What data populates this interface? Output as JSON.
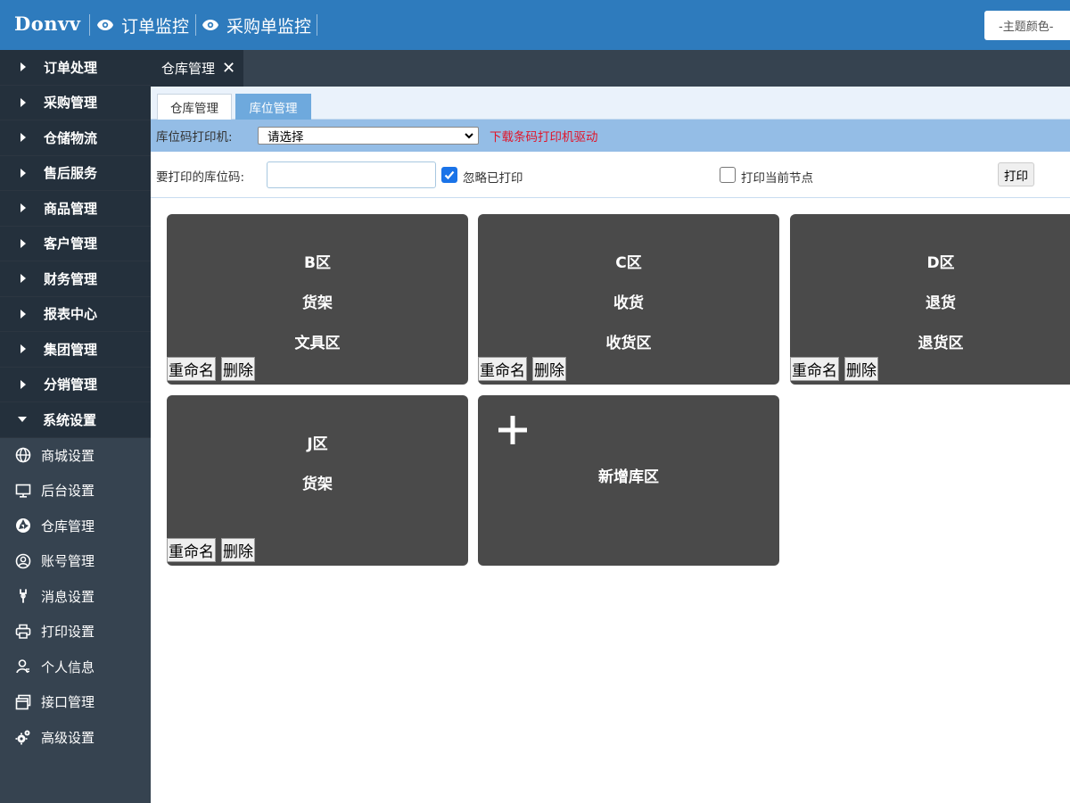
{
  "header": {
    "logo": "Donvv",
    "nav": [
      {
        "label": "订单监控",
        "icon": "eye-icon"
      },
      {
        "label": "采购单监控",
        "icon": "eye-icon"
      }
    ],
    "theme_button": "-主题颜色-"
  },
  "sidebar": {
    "menus": [
      {
        "label": "订单处理"
      },
      {
        "label": "采购管理"
      },
      {
        "label": "仓储物流"
      },
      {
        "label": "售后服务"
      },
      {
        "label": "商品管理"
      },
      {
        "label": "客户管理"
      },
      {
        "label": "财务管理"
      },
      {
        "label": "报表中心"
      },
      {
        "label": "集团管理"
      },
      {
        "label": "分销管理"
      },
      {
        "label": "系统设置"
      }
    ],
    "sub_items": [
      {
        "label": "商城设置",
        "icon": "globe-icon"
      },
      {
        "label": "后台设置",
        "icon": "monitor-icon"
      },
      {
        "label": "仓库管理",
        "icon": "aperture-icon"
      },
      {
        "label": "账号管理",
        "icon": "user-circle-icon"
      },
      {
        "label": "消息设置",
        "icon": "wrench-icon"
      },
      {
        "label": "打印设置",
        "icon": "printer-icon"
      },
      {
        "label": "个人信息",
        "icon": "user-icon"
      },
      {
        "label": "接口管理",
        "icon": "windows-icon"
      },
      {
        "label": "高级设置",
        "icon": "gears-icon"
      }
    ]
  },
  "page_tab": {
    "label": "仓库管理",
    "close": "✕"
  },
  "sub_tabs": [
    {
      "label": "仓库管理"
    },
    {
      "label": "库位管理"
    }
  ],
  "printer": {
    "label": "库位码打印机:",
    "selected": "请选择",
    "driver_link": "下载条码打印机驱动"
  },
  "code_row": {
    "label": "要打印的库位码:",
    "input_value": "",
    "ignore_printed": {
      "label": "忽略已打印",
      "checked": true
    },
    "print_current": {
      "label": "打印当前节点",
      "checked": false
    },
    "print_button": "打印"
  },
  "zones": [
    {
      "zone": "B区",
      "type": "货架",
      "name": "文具区",
      "rename": "重命名",
      "delete": "删除"
    },
    {
      "zone": "C区",
      "type": "收货",
      "name": "收货区",
      "rename": "重命名",
      "delete": "删除"
    },
    {
      "zone": "D区",
      "type": "退货",
      "name": "退货区",
      "rename": "重命名",
      "delete": "删除"
    },
    {
      "zone": "J区",
      "type": "货架",
      "name": "",
      "rename": "重命名",
      "delete": "删除"
    }
  ],
  "add_zone": {
    "label": "新增库区",
    "icon": "plus-icon"
  },
  "colors": {
    "header_bg": "#2e7bbd",
    "sidebar_bg": "#364350",
    "card_bg": "#4a4a4a",
    "link_red": "#e0162b",
    "active_tab": "#6ea9dd"
  }
}
